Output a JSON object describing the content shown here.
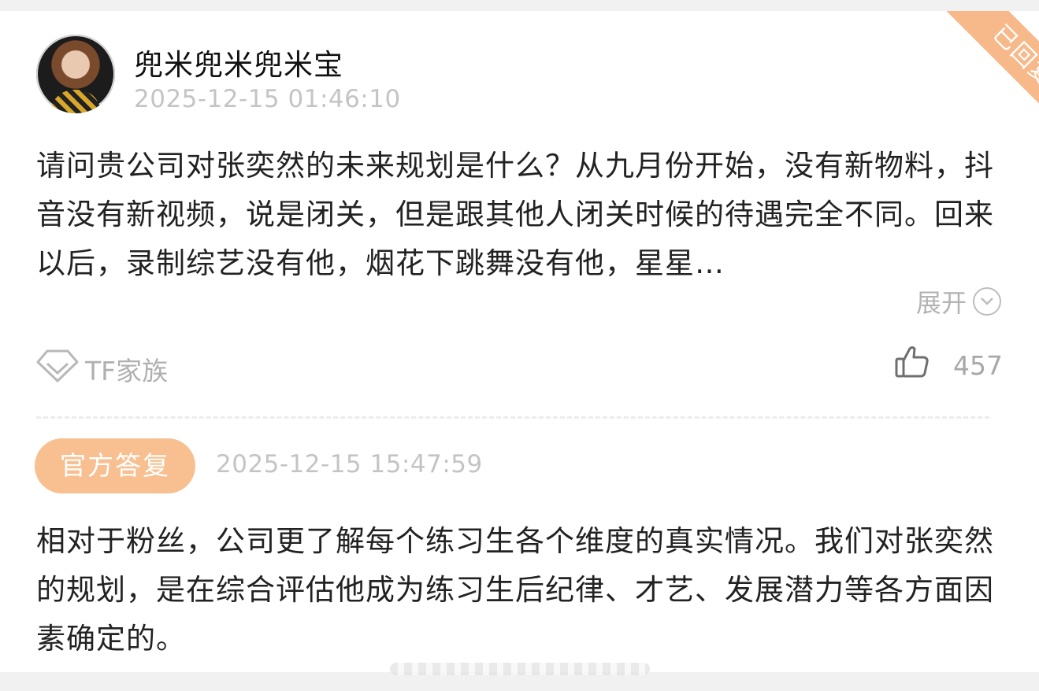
{
  "question_card": {
    "user": {
      "name": "兜米兜米兜米宝"
    },
    "timestamp": "2025-12-15 01:46:10",
    "status_ribbon": "已回复",
    "question_text": "请问贵公司对张奕然的未来规划是什么？从九月份开始，没有新物料，抖音没有新视频，说是闭关，但是跟其他人闭关时候的待遇完全不同。回来以后，录制综艺没有他，烟花下跳舞没有他，星星…",
    "expand_label": "展开",
    "topic": {
      "icon": "diamond-tag-icon",
      "label": "TF家族"
    },
    "like": {
      "icon": "thumbs-up-icon",
      "count": "457"
    }
  },
  "official_reply": {
    "badge": "官方答复",
    "timestamp": "2025-12-15 15:47:59",
    "text": "相对于粉丝，公司更了解每个练习生各个维度的真实情况。我们对张奕然的规划，是在综合评估他成为练习生后纪律、才艺、发展潜力等各方面因素确定的。"
  },
  "colors": {
    "accent_orange": "#f8c091",
    "muted_text": "#c4c4c4",
    "body_text": "#222222"
  }
}
